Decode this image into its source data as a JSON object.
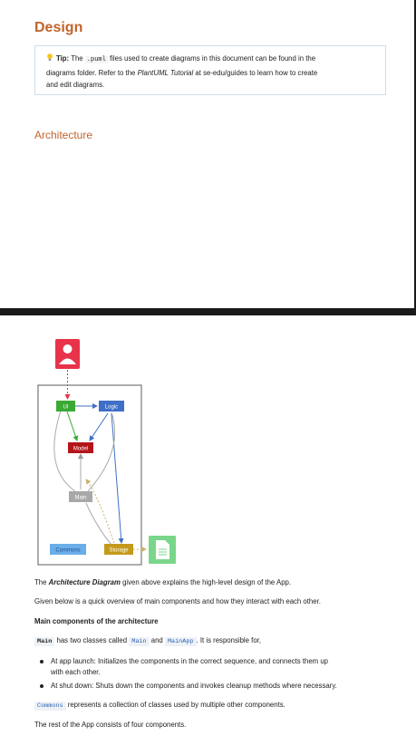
{
  "design": {
    "title": "Design",
    "tip": {
      "label": "Tip:",
      "text_before": "The",
      "code": ".puml",
      "text_mid": "files used to create diagrams in this document can be found in the",
      "line2_start": "diagrams folder. Refer to the",
      "link": "PlantUML Tutorial",
      "line2_end": "at se-edu/guides to learn how to create",
      "line3": "and edit diagrams."
    },
    "architecture_heading": "Architecture"
  },
  "diagram": {
    "nodes": {
      "ui": "UI",
      "logic": "Logic",
      "model": "Model",
      "main": "Main",
      "commons": "Commons",
      "storage": "Storage"
    },
    "colors": {
      "user": "#e8334a",
      "ui": "#3aaa35",
      "logic": "#3f6fc6",
      "model": "#b3151b",
      "main": "#a8a8a8",
      "commons": "#6aaee9",
      "storage": "#c49a1c",
      "file": "#7ad68a"
    },
    "icons": [
      "user-icon",
      "file-icon"
    ]
  },
  "content": {
    "para1_start": "The",
    "para1_bold": "Architecture Diagram",
    "para1_end": "given above explains the high-level design of the App.",
    "para2": "Given below is a quick overview of main components and how they interact with each other.",
    "main_heading": "Main components of the architecture",
    "main_line_code1": "Main",
    "main_line_text1": "has two classes called",
    "main_line_code2": "Main",
    "main_line_and": "and",
    "main_line_code3": "MainApp",
    "main_line_text2": ". It is responsible for,",
    "bullet1_line1": "At app launch: Initializes the components in the correct sequence, and connects them up",
    "bullet1_line2": "with each other.",
    "bullet2": "At shut down: Shuts down the components and invokes cleanup methods where necessary.",
    "commons_code": "Commons",
    "commons_text": "represents a collection of classes used by multiple other components.",
    "rest": "The rest of the App consists of four components."
  }
}
